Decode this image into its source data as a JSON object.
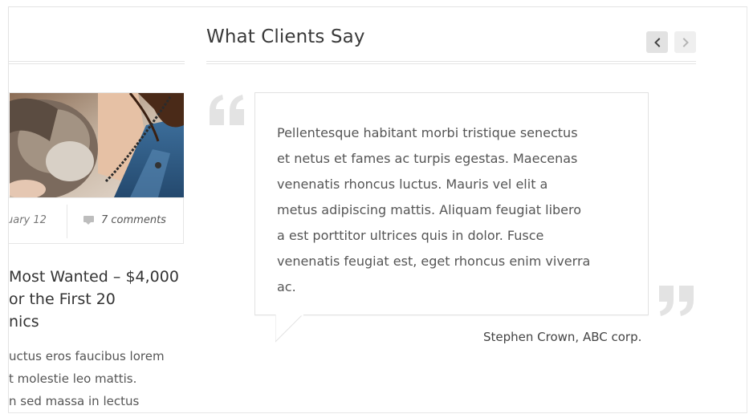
{
  "blog_post": {
    "date_fragment": "uary 12",
    "comments": "7 comments",
    "title_lines": [
      "Most Wanted – $4,000",
      "or the First 20",
      "nics"
    ],
    "excerpt_lines": [
      "uctus eros faucibus lorem",
      "t molestie leo mattis.",
      "n sed massa in lectus"
    ]
  },
  "testimonials": {
    "title": "What Clients Say",
    "quote_lines": [
      "Pellentesque habitant morbi tristique senectus",
      "et netus et fames ac turpis egestas. Maecenas",
      "venenatis rhoncus luctus. Mauris vel elit a",
      "metus adipiscing mattis. Aliquam feugiat libero",
      "a est porttitor ultrices quis in dolor. Fusce",
      "venenatis feugiat est, eget rhoncus enim viverra",
      "ac."
    ],
    "author": "Stephen Crown, ABC corp."
  },
  "icons": {
    "prev": "chevron-left-icon",
    "next": "chevron-right-icon",
    "comment": "comment-icon",
    "quote_open": "quote-open-icon",
    "quote_close": "quote-close-icon"
  },
  "colors": {
    "rule": "#e4e4e4",
    "quote_mark": "#e3e3e3",
    "text": "#555555",
    "heading": "#3a3a3a"
  }
}
